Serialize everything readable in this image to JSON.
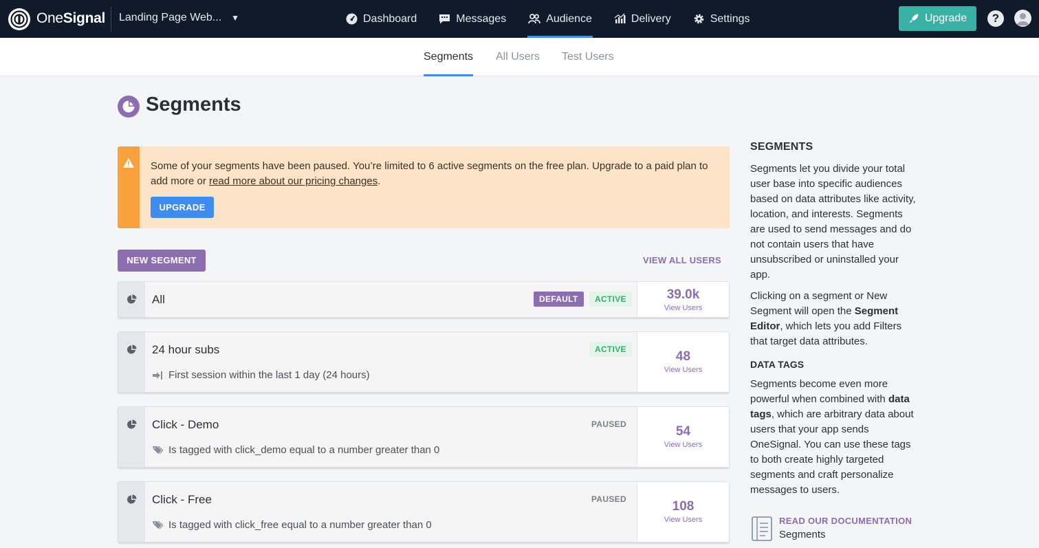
{
  "brand": {
    "name_light": "One",
    "name_bold": "Signal"
  },
  "app_selector": {
    "label": "Landing Page Web...",
    "caret": "▼"
  },
  "nav": [
    {
      "label": "Dashboard",
      "icon": "dashboard-icon"
    },
    {
      "label": "Messages",
      "icon": "messages-icon"
    },
    {
      "label": "Audience",
      "icon": "audience-icon",
      "active": true
    },
    {
      "label": "Delivery",
      "icon": "delivery-icon"
    },
    {
      "label": "Settings",
      "icon": "gear-icon"
    }
  ],
  "upgrade_button": "Upgrade",
  "help": "?",
  "subtabs": [
    {
      "label": "Segments",
      "active": true
    },
    {
      "label": "All Users"
    },
    {
      "label": "Test Users"
    }
  ],
  "page_title": "Segments",
  "alert": {
    "text_before": "Some of your segments have been paused. You’re limited to 6 active segments on the free plan. Upgrade to a paid plan to add more or ",
    "link": "read more about our pricing changes",
    "text_after": ".",
    "button": "UPGRADE"
  },
  "list": {
    "new_segment": "NEW SEGMENT",
    "view_all_users": "VIEW ALL USERS"
  },
  "segments": [
    {
      "name": "All",
      "badges": [
        "DEFAULT",
        "ACTIVE"
      ],
      "description": "",
      "count": "39.0k",
      "view_users": "View Users"
    },
    {
      "name": "24 hour subs",
      "badges": [
        "ACTIVE"
      ],
      "description": "First session within the last 1 day (24 hours)",
      "count": "48",
      "view_users": "View Users"
    },
    {
      "name": "Click - Demo",
      "badges": [
        "PAUSED"
      ],
      "description": "Is tagged with click_demo equal to a number greater than 0",
      "count": "54",
      "view_users": "View Users"
    },
    {
      "name": "Click - Free",
      "badges": [
        "PAUSED"
      ],
      "description": "Is tagged with click_free equal to a number greater than 0",
      "count": "108",
      "view_users": "View Users"
    }
  ],
  "sidebar": {
    "heading": "SEGMENTS",
    "p1": "Segments let you divide your total user base into specific audiences based on data attributes like activity, location, and interests. Segments are used to send messages and do not contain users that have unsubscribed or uninstalled your app.",
    "p2_a": "Clicking on a segment or New Segment will open the ",
    "p2_b": "Segment Editor",
    "p2_c": ", which lets you add Filters that target data attributes.",
    "subheading": "DATA TAGS",
    "p3_a": "Segments become even more powerful when combined with ",
    "p3_b": "data tags",
    "p3_c": ", which are arbitrary data about users that your app sends OneSignal. You can use these tags to both create highly targeted segments and craft personalize messages to users.",
    "doc_title": "READ OUR DOCUMENTATION",
    "doc_sub": "Segments"
  },
  "colors": {
    "topbar": "#0f1a2b",
    "accent_blue": "#3f8cf0",
    "purple": "#8b6db0",
    "teal": "#3ab1a5",
    "alert_bg": "#fde3c7",
    "alert_bar": "#f9a23d",
    "active_green": "#34b06a"
  }
}
